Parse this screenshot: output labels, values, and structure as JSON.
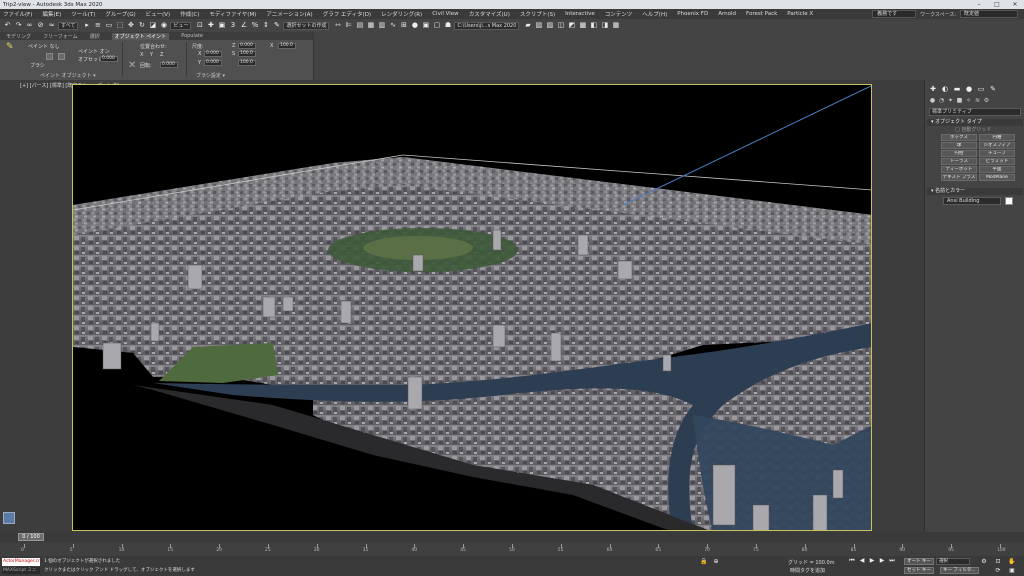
{
  "titlebar": {
    "title": "Trip2-view - Autodesk 3ds Max 2020",
    "min": "–",
    "max": "□",
    "close": "✕"
  },
  "menu": {
    "items": [
      "ファイル(F)",
      "編集(E)",
      "ツール(T)",
      "グループ(G)",
      "ビュー(V)",
      "作成(C)",
      "モディファイヤ(M)",
      "アニメーション(A)",
      "グラフ エディタ(D)",
      "レンダリング(R)",
      "Civil View",
      "カスタマイズ(U)",
      "スクリプト(S)",
      "Interactive",
      "コンテンツ",
      "ヘルプ(H)",
      "Phoenix FD",
      "Arnold",
      "Forest Pack",
      "Particle X"
    ],
    "account": "義務です",
    "workspace_label": "ワークスペース:",
    "workspace_value": "既定値"
  },
  "toolbar": {
    "filter_dropdown": "すべて",
    "view_dropdown": "ビュー",
    "selset_dropdown": "選択セットの作成",
    "path_dropdown": "C:\\Users\\ji...s Max 2020"
  },
  "ribbon": {
    "tabs": [
      "モデリング",
      "フリーフォーム",
      "選択",
      "オブジェクト ペイント",
      "Populate"
    ],
    "active_tab": 3,
    "paint_off": "ペイント なし",
    "paint_on": "ペイント オン",
    "brush_label": "ブラシ",
    "spacing_label": "間隔",
    "offset_label": "オフセット:",
    "offset_value": "0.000",
    "align_label": "位置合わせ:",
    "rotate_label": "回転:",
    "scale_label": "尺度:",
    "rotate_value": "0.000",
    "x_value": "0.000",
    "y_value": "0.000",
    "z_value": "0.000",
    "s_value": "100.0",
    "group_paint": "ペイント オブジェクト ▾",
    "group_brush": "ブラシ設定 ▾"
  },
  "viewport": {
    "label": "[+] [パース] [標準] [既定のシェーディング]"
  },
  "command_panel": {
    "category": "標準プリミティブ",
    "rollout_type": "▾ オブジェクト タイプ",
    "autogrid": "□ 自動グリッド",
    "buttons": [
      "ボックス",
      "円錐",
      "球",
      "ジオスフィア",
      "円柱",
      "チューブ",
      "トーラス",
      "ピラミッド",
      "ティーポット",
      "平面",
      "テキスト プラス",
      "ModPlane"
    ],
    "rollout_name": "▾ 名前とカラー",
    "object_name": "Ansi Building",
    "swatch_color": "#ffffff"
  },
  "timeline": {
    "slider_label": "0 / 100",
    "ticks": [
      "0",
      "5",
      "10",
      "15",
      "20",
      "25",
      "30",
      "35",
      "40",
      "45",
      "50",
      "55",
      "60",
      "65",
      "70",
      "75",
      "80",
      "85",
      "90",
      "95",
      "100"
    ]
  },
  "status": {
    "maxscript_top": "ActorManager.cr",
    "maxscript_bottom": "MAXScript ミニ",
    "msg_top": "1 個のオブジェクトが選択されました",
    "msg_bottom": "クリックまたはクリック アンド ドラッグして、オブジェクトを選択します",
    "grid": "グリッド = 100.0m",
    "add_time_tag": "時間タグを追加",
    "autokey": "オート キー",
    "setkey": "セット キー",
    "selected_dd": "選択",
    "keyfilter": "キー フィルタ..."
  },
  "colors": {
    "viewport_border": "#c8c25a",
    "city_ground": "#6f6e73",
    "river": "#2e3e52",
    "sky_line": "#4a7fc0"
  }
}
